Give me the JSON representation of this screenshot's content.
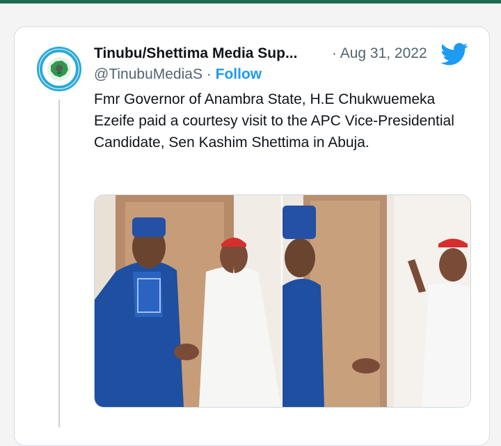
{
  "tweet": {
    "display_name": "Tinubu/Shettima Media Sup...",
    "separator": "·",
    "date": "Aug 31, 2022",
    "handle": "@TinubuMediaS",
    "follow_separator": "·",
    "follow_label": "Follow",
    "text": "Fmr Governor of Anambra State, H.E Chukwuemeka  Ezeife paid a courtesy visit to the APC Vice-Presidential Candidate, Sen Kashim Shettima in Abuja."
  },
  "icons": {
    "brand": "twitter-bird-icon",
    "avatar": "media-support-logo"
  },
  "colors": {
    "top_strip": "#1f6b52",
    "link": "#1d9bf0",
    "secondary_text": "#536471",
    "avatar_ring": "#2aa9d8"
  }
}
